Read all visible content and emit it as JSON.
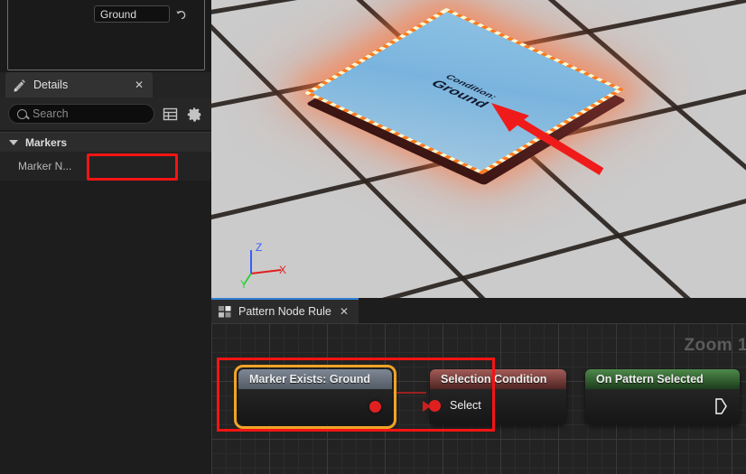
{
  "left_panel": {
    "empty_panel_name": "viewport-outliner-placeholder",
    "details_tab": {
      "label": "Details",
      "icon": "details-pencil-icon",
      "close_label": "✕"
    },
    "search": {
      "placeholder": "Search",
      "value": "",
      "icon": "search-icon"
    },
    "toolbar_icons": [
      {
        "name": "column-settings-icon",
        "glyph": "grid"
      },
      {
        "name": "view-options-gear-icon",
        "glyph": "gear"
      }
    ],
    "category": {
      "label": "Markers",
      "expanded": true,
      "caret": "▼"
    },
    "property": {
      "name": "Marker N...",
      "full_name": "Marker Name",
      "value": "Ground",
      "placeholder": "",
      "revert_icon": "revert-arrow-icon"
    }
  },
  "viewport": {
    "name": "3d-viewport",
    "floor_color": "#cbcbcb",
    "grid_line_color": "#2a2320",
    "plane": {
      "line1": "Condition:",
      "line2": "Ground",
      "top_color": "#7ab4de",
      "outline_color": "#ff7a1e",
      "side_color": "#5b2220"
    },
    "gizmo": {
      "x_label": "X",
      "x_color": "#e02020",
      "y_label": "Y",
      "y_color": "#2fd23a",
      "z_label": "Z",
      "z_color": "#3a5cff"
    },
    "annotation_arrow_color": "#ef1b1b"
  },
  "graph": {
    "tab": {
      "label": "Pattern Node Rule",
      "icon": "graph-grid-icon",
      "close_label": "✕",
      "active_accent": "#2f7fd4"
    },
    "zoom_label": "Zoom 1",
    "nodes": [
      {
        "name": "node-marker-exists",
        "title": "Marker Exists: Ground",
        "title_color": "#6b7480",
        "selected": true,
        "selection_color": "#f0a526",
        "output_pin": {
          "name": "bool-output-pin",
          "label": "",
          "color": "#e02020"
        }
      },
      {
        "name": "node-selection-condition",
        "title": "Selection Condition",
        "title_color": "#8a4844",
        "selected": false,
        "input_pin": {
          "name": "select-input-pin",
          "label": "Select",
          "color": "#e02020"
        }
      },
      {
        "name": "node-on-pattern-selected",
        "title": "On Pattern Selected",
        "title_color": "#3f7a3c",
        "selected": false,
        "exec_pin": {
          "name": "exec-output-pin",
          "label": "",
          "color": "#ffffff"
        }
      }
    ],
    "wire_color": "#c32020"
  },
  "annotations": {
    "highlight_color": "#f41414",
    "marker_field_highlight": "marker-name-highlight",
    "node_highlight": "marker-node-highlight"
  }
}
